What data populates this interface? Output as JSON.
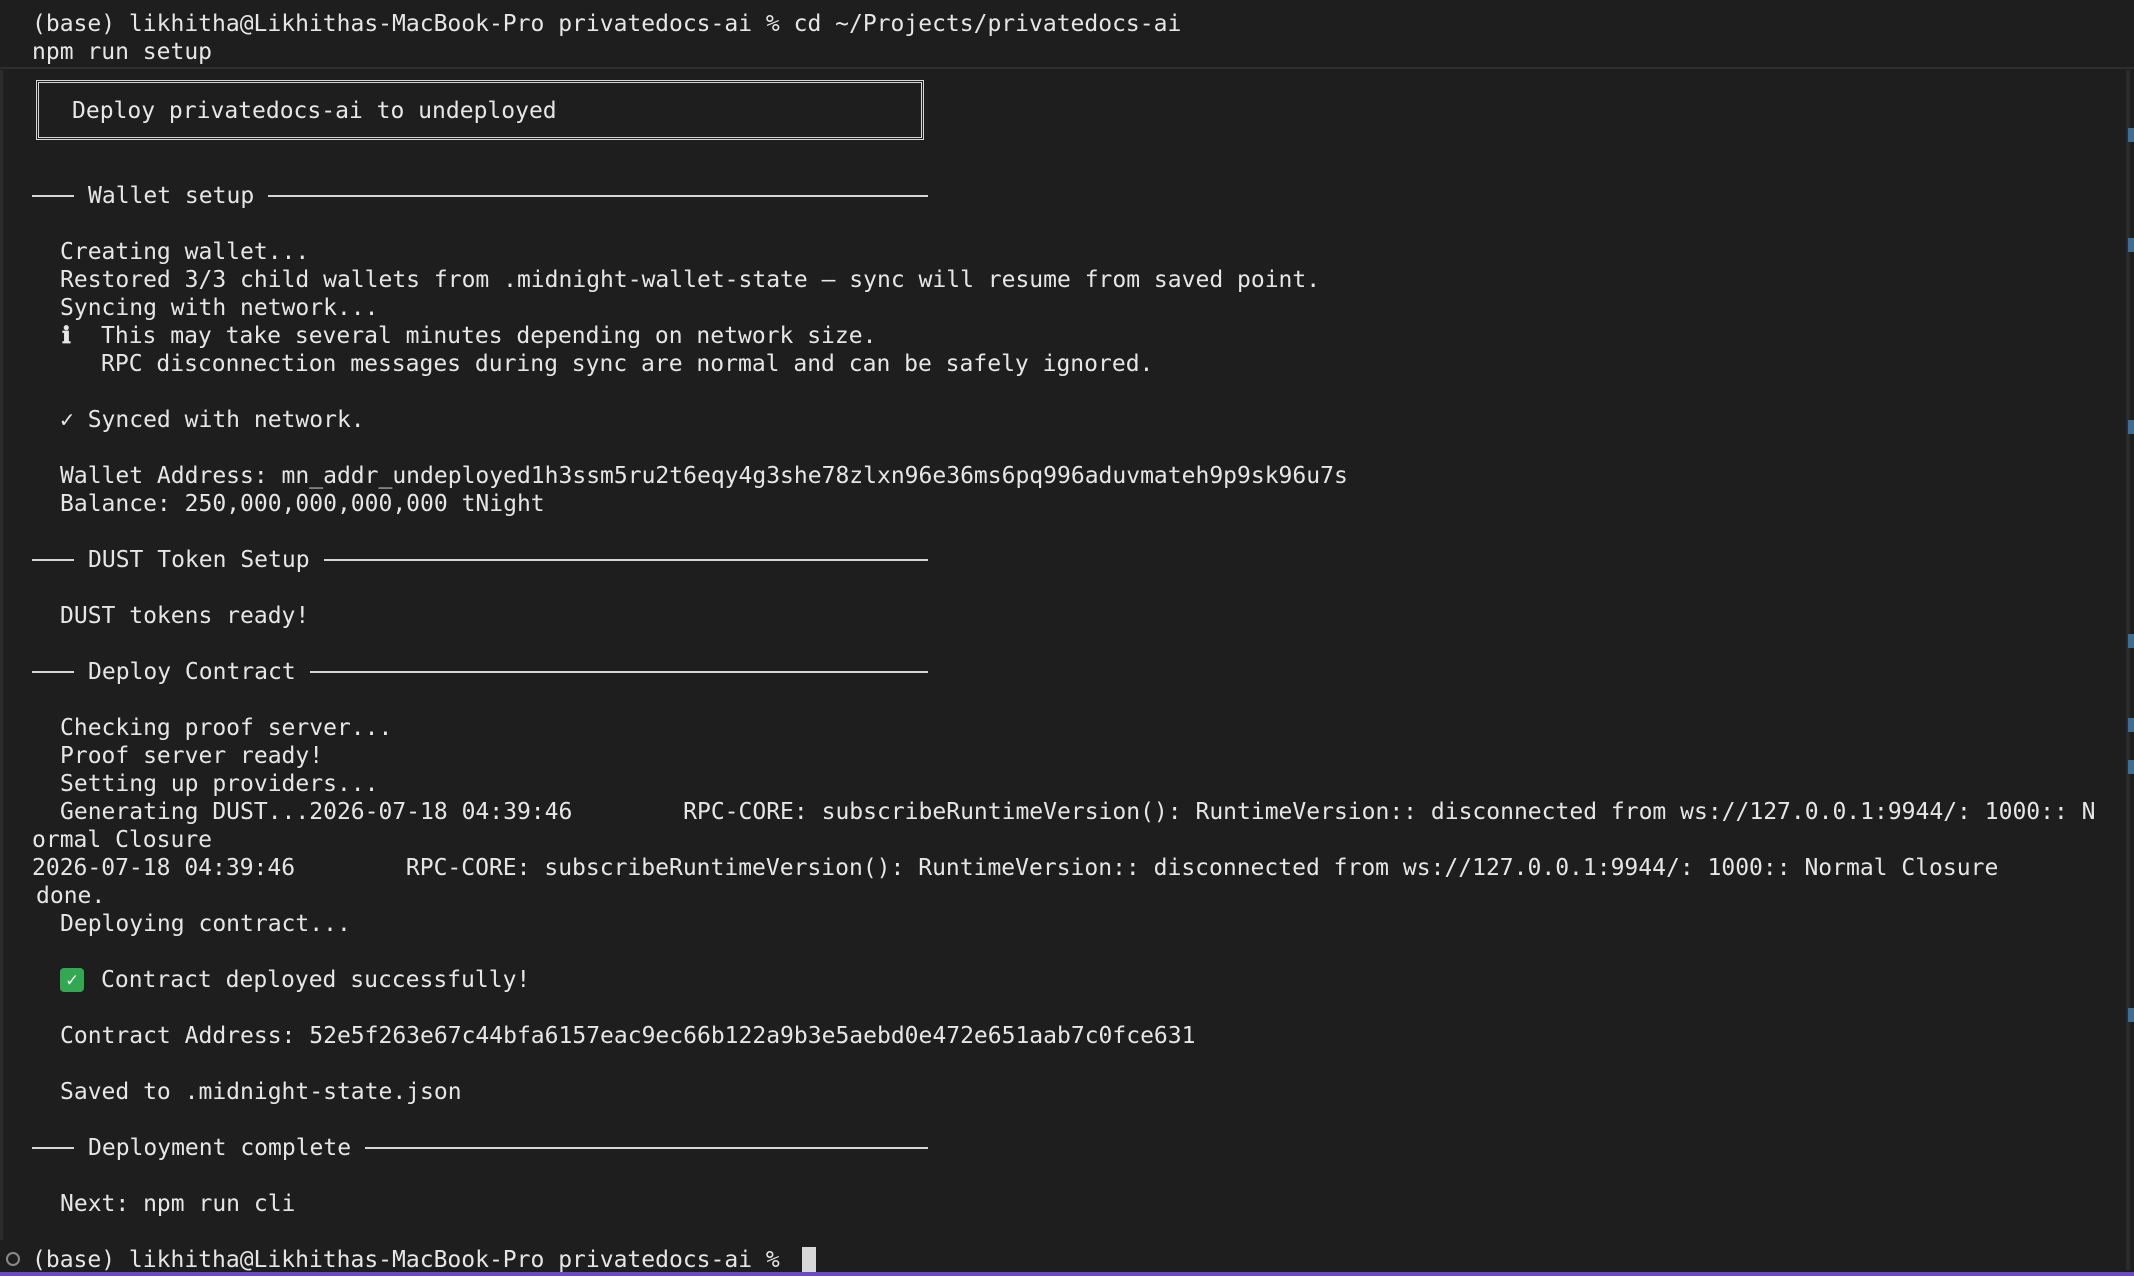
{
  "terminal": {
    "header": {
      "line1": "(base) likhitha@Likhithas-MacBook-Pro privatedocs-ai % cd ~/Projects/privatedocs-ai",
      "line2": "npm run setup"
    },
    "banner": "Deploy privatedocs-ai to undeployed",
    "sections": {
      "wallet": "Wallet setup",
      "dust": "DUST Token Setup",
      "deploy": "Deploy Contract",
      "complete": "Deployment complete"
    },
    "wallet": {
      "creating": "Creating wallet...",
      "restored": "Restored 3/3 child wallets from .midnight-wallet-state — sync will resume from saved point.",
      "syncing": "Syncing with network...",
      "info_icon": "ℹ",
      "info1": "This may take several minutes depending on network size.",
      "info2": "RPC disconnection messages during sync are normal and can be safely ignored.",
      "synced": "✓ Synced with network.",
      "address": "Wallet Address: mn_addr_undeployed1h3ssm5ru2t6eqy4g3she78zlxn96e36ms6pq996aduvmateh9p9sk96u7s",
      "balance": "Balance: 250,000,000,000,000 tNight"
    },
    "dust": {
      "ready": "DUST tokens ready!"
    },
    "deploy": {
      "checking": "Checking proof server...",
      "proof_ready": "Proof server ready!",
      "providers": "Setting up providers...",
      "generating": "Generating DUST...2026-07-18 04:39:46        RPC-CORE: subscribeRuntimeVersion(): RuntimeVersion:: disconnected from ws://127.0.0.1:9944/: 1000:: N",
      "wrap": "ormal Closure",
      "rpc2": "2026-07-18 04:39:46        RPC-CORE: subscribeRuntimeVersion(): RuntimeVersion:: disconnected from ws://127.0.0.1:9944/: 1000:: Normal Closure",
      "done": "done.",
      "deploying": "Deploying contract...",
      "check_icon": "✓",
      "success": "Contract deployed successfully!",
      "contract_address": "Contract Address: 52e5f263e67c44bfa6157eac9ec66b122a9b3e5aebd0e472e651aab7c0fce631",
      "saved": "Saved to .midnight-state.json"
    },
    "complete": {
      "next": "Next: npm run cli"
    },
    "prompt": "(base) likhitha@Likhithas-MacBook-Pro privatedocs-ai %"
  },
  "colors": {
    "background": "#1e1e1e",
    "text": "#e6e6e6",
    "success": "#33a852",
    "border_accent": "#6d4ac1"
  }
}
